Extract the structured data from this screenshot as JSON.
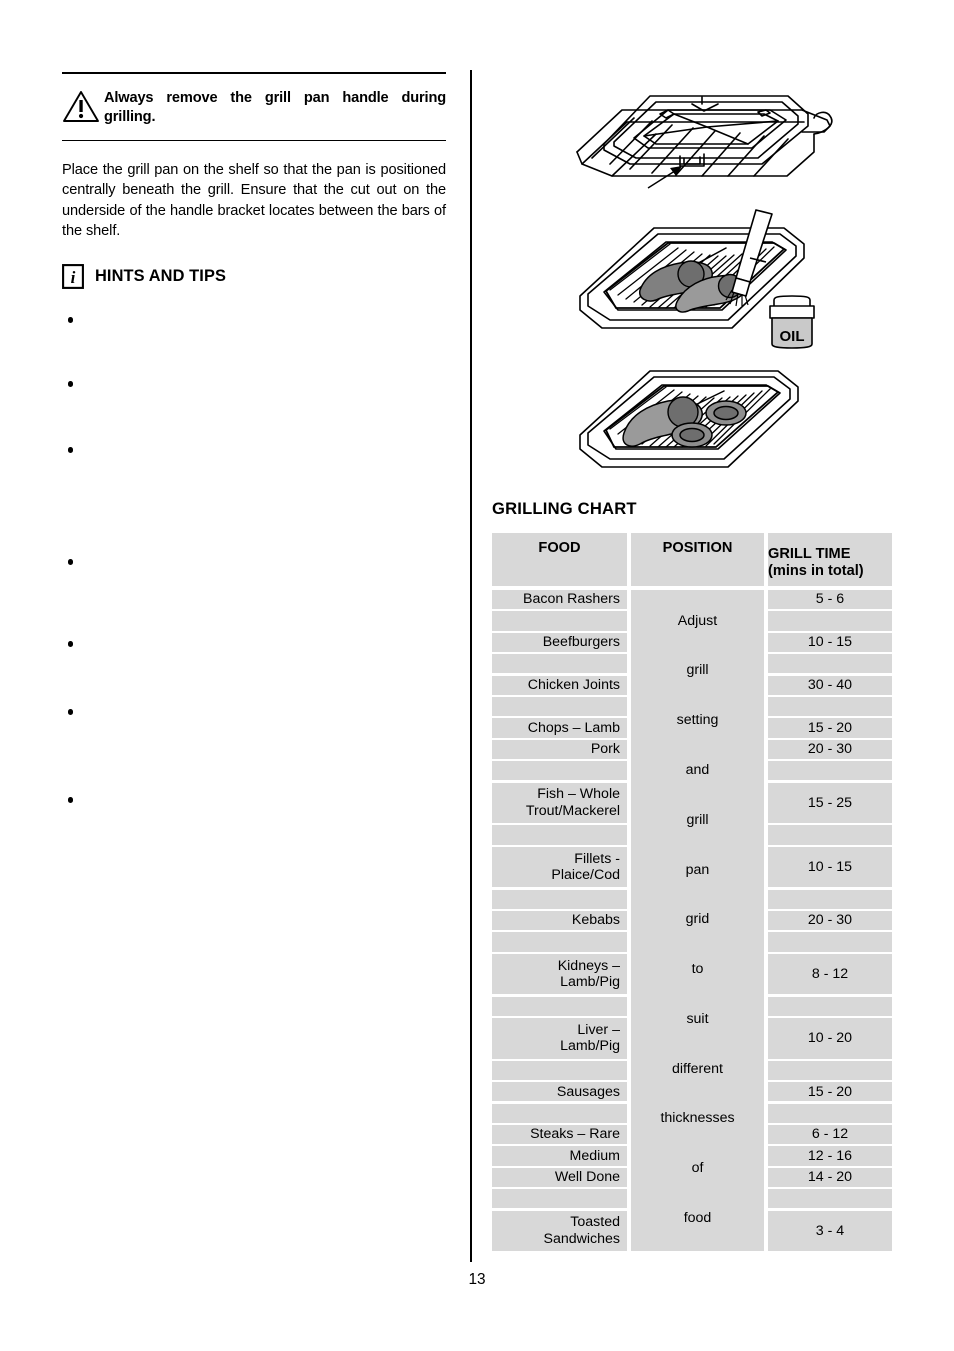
{
  "page": {
    "number": "13"
  },
  "warning": {
    "icon": "warning-triangle-icon",
    "text": "Always remove the grill pan handle during grilling."
  },
  "body": {
    "paragraph": "Place the grill pan on the shelf so that the pan is positioned centrally beneath the grill.  Ensure that the cut out on the underside of the handle bracket locates between the bars of the shelf."
  },
  "hints": {
    "icon": "info-icon",
    "title": "HINTS AND TIPS",
    "items": [
      "",
      "",
      "",
      "",
      "",
      "",
      ""
    ]
  },
  "figures": [
    {
      "name": "grill-pan-on-shelf-figure",
      "caption": ""
    },
    {
      "name": "grill-pan-with-oil-brush-figure",
      "caption": "",
      "label": "OIL"
    },
    {
      "name": "grill-pan-with-food-figure",
      "caption": ""
    }
  ],
  "chart": {
    "title": "GRILLING CHART",
    "columns": [
      "FOOD",
      "POSITION",
      "GRILL TIME"
    ],
    "column_subtitles": [
      "",
      "",
      "(mins in total)"
    ],
    "position_words": [
      "Adjust",
      "grill",
      "setting",
      "and",
      "grill",
      "pan",
      "grid",
      "to",
      "suit",
      "different",
      "thicknesses",
      "of",
      "food"
    ],
    "rows": [
      {
        "food_line1": "Bacon Rashers",
        "food_line2": "",
        "time": "5 - 6"
      },
      {
        "food_line1": "Beefburgers",
        "food_line2": "",
        "time": "10 - 15"
      },
      {
        "food_line1": "Chicken Joints",
        "food_line2": "",
        "time": "30 - 40"
      },
      {
        "food_line1": "Chops – Lamb",
        "food_line2": "",
        "time": "15 - 20"
      },
      {
        "food_line1": "Pork",
        "food_line2": "",
        "time": "20 - 30"
      },
      {
        "food_line1": "Fish – Whole",
        "food_line2": "Trout/Mackerel",
        "time": "15 - 25"
      },
      {
        "food_line1": "Fillets -",
        "food_line2": "Plaice/Cod",
        "time": "10 - 15"
      },
      {
        "food_line1": "Kebabs",
        "food_line2": "",
        "time": "20 - 30"
      },
      {
        "food_line1": "Kidneys –",
        "food_line2": "Lamb/Pig",
        "time": "8 - 12"
      },
      {
        "food_line1": "Liver –",
        "food_line2": "Lamb/Pig",
        "time": "10 - 20"
      },
      {
        "food_line1": "Sausages",
        "food_line2": "",
        "time": "15 - 20"
      },
      {
        "food_line1": "Steaks – Rare",
        "food_line2": "",
        "time": "6 - 12"
      },
      {
        "food_line1": "Medium",
        "food_line2": "",
        "time": "12 - 16"
      },
      {
        "food_line1": "Well Done",
        "food_line2": "",
        "time": "14 - 20"
      },
      {
        "food_line1": "Toasted",
        "food_line2": "Sandwiches",
        "time": "3 - 4"
      }
    ]
  },
  "colors": {
    "cell_fill": "#d8d8d8",
    "text": "#000000",
    "page_bg": "#ffffff"
  }
}
